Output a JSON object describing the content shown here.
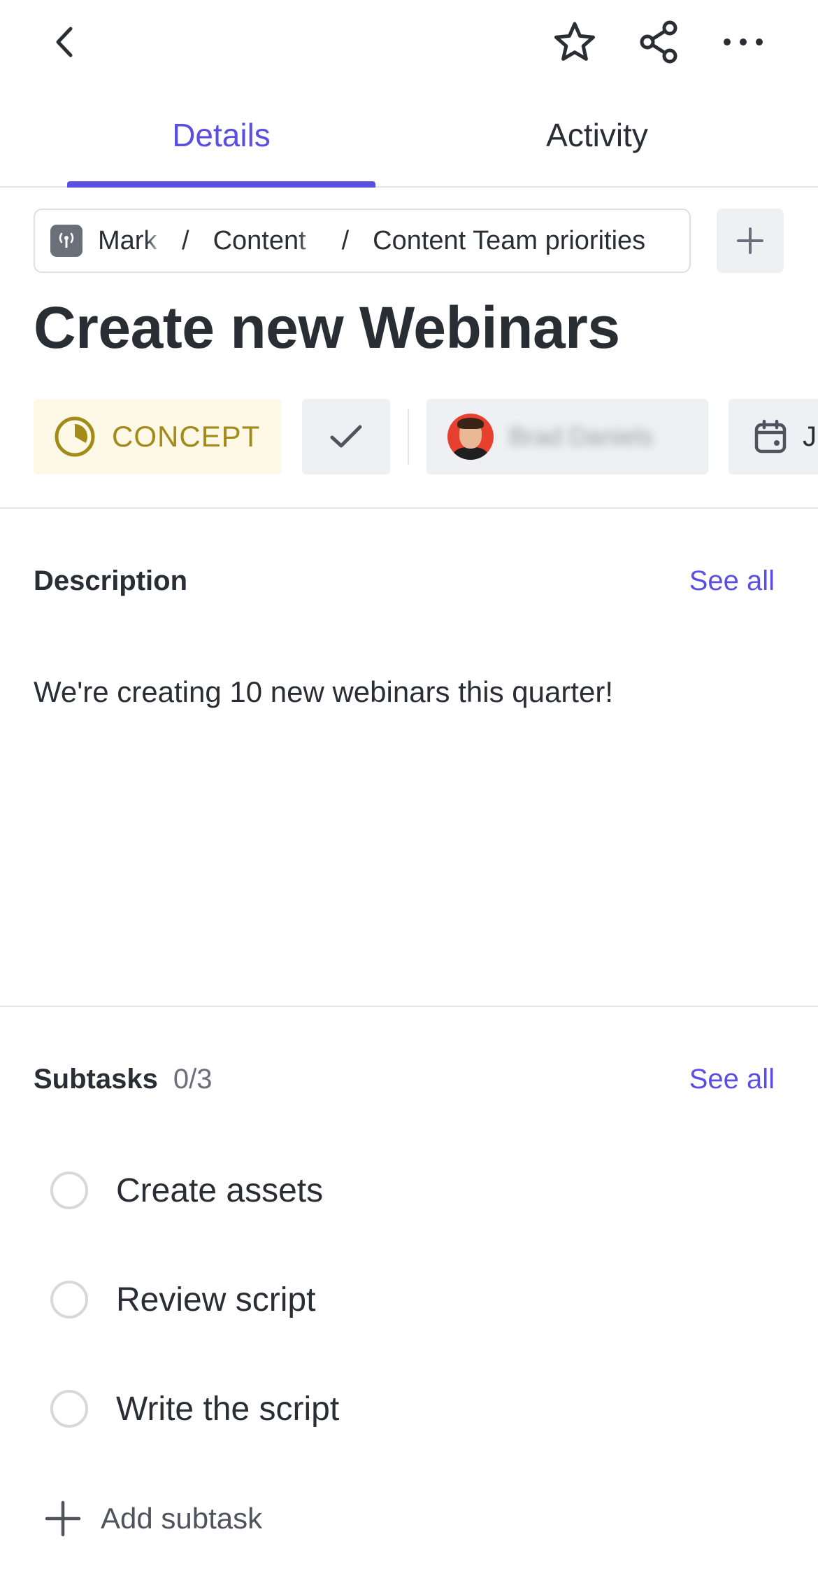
{
  "header": {
    "back_icon": "chevron-left-icon",
    "favorite_icon": "star-icon",
    "share_icon": "share-icon",
    "more_icon": "more-horizontal-icon"
  },
  "tabs": [
    {
      "label": "Details",
      "active": true
    },
    {
      "label": "Activity",
      "active": false
    }
  ],
  "breadcrumb": {
    "space_icon": "broadcast-icon",
    "items": [
      "Mark",
      "Content",
      "Content Team priorities"
    ],
    "separator": "/",
    "add_icon": "plus-icon"
  },
  "task": {
    "title": "Create new Webinars",
    "status": {
      "label": "CONCEPT",
      "icon": "status-progress-icon",
      "color": "#a38a19",
      "background": "#fdf9e6"
    },
    "complete_icon": "checkmark-icon",
    "assignee": {
      "avatar_icon": "avatar",
      "name": "Brad Daniels"
    },
    "due_date": {
      "icon": "calendar-icon",
      "label": "J"
    }
  },
  "description": {
    "heading": "Description",
    "see_all": "See all",
    "text": "We're creating 10 new webinars this quarter!"
  },
  "subtasks": {
    "heading": "Subtasks",
    "count": "0/3",
    "see_all": "See all",
    "items": [
      {
        "label": "Create assets",
        "done": false
      },
      {
        "label": "Review script",
        "done": false
      },
      {
        "label": "Write the script",
        "done": false
      }
    ],
    "add_label": "Add subtask"
  },
  "colors": {
    "accent": "#5b4ee0",
    "text": "#292d34",
    "muted": "#6b6f7a",
    "chip_bg": "#eef0f3",
    "divider": "#e3e4e8"
  }
}
